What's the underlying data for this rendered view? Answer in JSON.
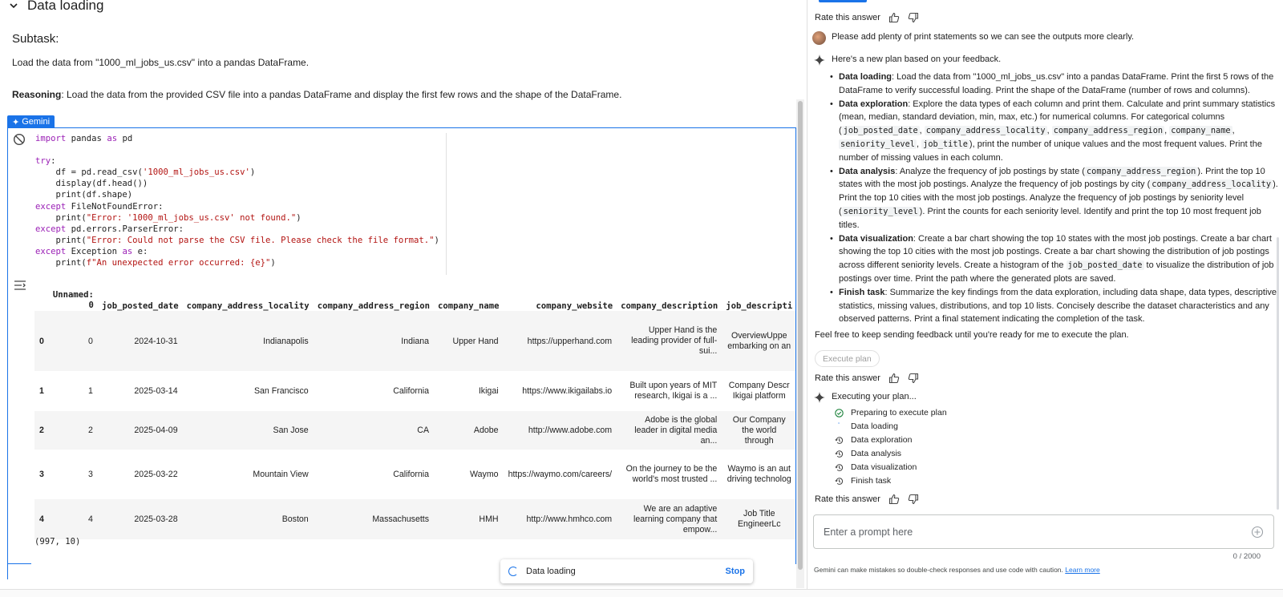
{
  "notebook": {
    "section_title": "Data loading",
    "subtask_heading": "Subtask:",
    "subtask_text": "Load the data from \"1000_ml_jobs_us.csv\" into a pandas DataFrame.",
    "reasoning_label": "Reasoning",
    "reasoning_text": ": Load the data from the provided CSV file into a pandas DataFrame and display the first few rows and the shape of the DataFrame.",
    "gemini_badge": "Gemini",
    "code": {
      "l1_kw": "import",
      "l1_a": " pandas ",
      "l1_kw2": "as",
      "l1_b": " pd",
      "l3_kw": "try",
      "l3_b": ":",
      "l4_a": "    df = pd.read_csv(",
      "l4_str": "'1000_ml_jobs_us.csv'",
      "l4_b": ")",
      "l5_a": "    display(df.head())",
      "l6_a": "    print(df.shape)",
      "l7_kw": "except",
      "l7_b": " FileNotFoundError:",
      "l8_a": "    print(",
      "l8_str": "\"Error: '1000_ml_jobs_us.csv' not found.\"",
      "l8_b": ")",
      "l9_kw": "except",
      "l9_b": " pd.errors.ParserError:",
      "l10_a": "    print(",
      "l10_str": "\"Error: Could not parse the CSV file. Please check the file format.\"",
      "l10_b": ")",
      "l11_kw": "except",
      "l11_b": " Exception ",
      "l11_kw2": "as",
      "l11_c": " e:",
      "l12_a": "    print(",
      "l12_str": "f\"An unexpected error occurred: {e}\"",
      "l12_b": ")"
    },
    "table": {
      "columns": [
        "",
        "Unnamed: 0",
        "job_posted_date",
        "company_address_locality",
        "company_address_region",
        "company_name",
        "company_website",
        "company_description",
        "job_descripti"
      ],
      "rows": [
        [
          "0",
          "0",
          "2024-10-31",
          "Indianapolis",
          "Indiana",
          "Upper Hand",
          "https://upperhand.com",
          "Upper Hand is the leading provider of full-sui...",
          "OverviewUppe embarking on an"
        ],
        [
          "1",
          "1",
          "2025-03-14",
          "San Francisco",
          "California",
          "Ikigai",
          "https://www.ikigailabs.io",
          "Built upon years of MIT research, Ikigai is a ...",
          "Company Descr Ikigai platform"
        ],
        [
          "2",
          "2",
          "2025-04-09",
          "San Jose",
          "CA",
          "Adobe",
          "http://www.adobe.com",
          "Adobe is the global leader in digital media an...",
          "Our Company the world through"
        ],
        [
          "3",
          "3",
          "2025-03-22",
          "Mountain View",
          "California",
          "Waymo",
          "https://waymo.com/careers/",
          "On the journey to be the world's most trusted ...",
          "Waymo is an aut driving technolog"
        ],
        [
          "4",
          "4",
          "2025-03-28",
          "Boston",
          "Massachusetts",
          "HMH",
          "http://www.hmhco.com",
          "We are an adaptive learning company that empow...",
          "Job Title EngineerLc"
        ]
      ]
    },
    "shape_output": "(997, 10)",
    "toast": {
      "text": "Data loading",
      "stop": "Stop"
    }
  },
  "panel": {
    "rate_label": "Rate this answer",
    "user_message": "Please add plenty of print statements so we can see the outputs more clearly.",
    "plan_intro": "Here's a new plan based on your feedback.",
    "plan": {
      "loading_label": "Data loading",
      "loading_text": ": Load the data from \"1000_ml_jobs_us.csv\" into a pandas DataFrame. Print the first 5 rows of the DataFrame to verify successful loading. Print the shape of the DataFrame (number of rows and columns).",
      "exploration_label": "Data exploration",
      "exploration_text_a": ": Explore the data types of each column and print them. Calculate and print summary statistics (mean, median, standard deviation, min, max, etc.) for numerical columns. For categorical columns (",
      "exploration_code1": "job_posted_date",
      "exploration_code2": "company_address_locality",
      "exploration_code3": "company_address_region",
      "exploration_code4": "company_name",
      "exploration_code5": "seniority_level",
      "exploration_code6": "job_title",
      "exploration_text_b": "), print the number of unique values and the most frequent values. Print the number of missing values in each column.",
      "analysis_label": "Data analysis",
      "analysis_text_a": ": Analyze the frequency of job postings by state (",
      "analysis_code1": "company_address_region",
      "analysis_text_b": "). Print the top 10 states with the most job postings. Analyze the frequency of job postings by city (",
      "analysis_code2": "company_address_locality",
      "analysis_text_c": "). Print the top 10 cities with the most job postings. Analyze the frequency of job postings by seniority level (",
      "analysis_code3": "seniority_level",
      "analysis_text_d": "). Print the counts for each seniority level. Identify and print the top 10 most frequent job titles.",
      "viz_label": "Data visualization",
      "viz_text_a": ": Create a bar chart showing the top 10 states with the most job postings. Create a bar chart showing the top 10 cities with the most job postings. Create a bar chart showing the distribution of job postings across different seniority levels. Create a histogram of the ",
      "viz_code": "job_posted_date",
      "viz_text_b": " to visualize the distribution of job postings over time. Print the path where the generated plots are saved.",
      "finish_label": "Finish task",
      "finish_text": ": Summarize the key findings from the data exploration, including data shape, data types, descriptive statistics, missing values, distributions, and top 10 lists. Concisely describe the dataset characteristics and any observed patterns. Print a final statement indicating the completion of the task."
    },
    "feedback_text": "Feel free to keep sending feedback until you're ready for me to execute the plan.",
    "execute_button": "Execute plan",
    "executing_text": "Executing your plan...",
    "steps": [
      "Preparing to execute plan",
      "Data loading",
      "Data exploration",
      "Data analysis",
      "Data visualization",
      "Finish task"
    ],
    "prompt_placeholder": "Enter a prompt here",
    "counter": "0 / 2000",
    "disclaimer": "Gemini can make mistakes so double-check responses and use code with caution.",
    "learn_more": "Learn more"
  }
}
